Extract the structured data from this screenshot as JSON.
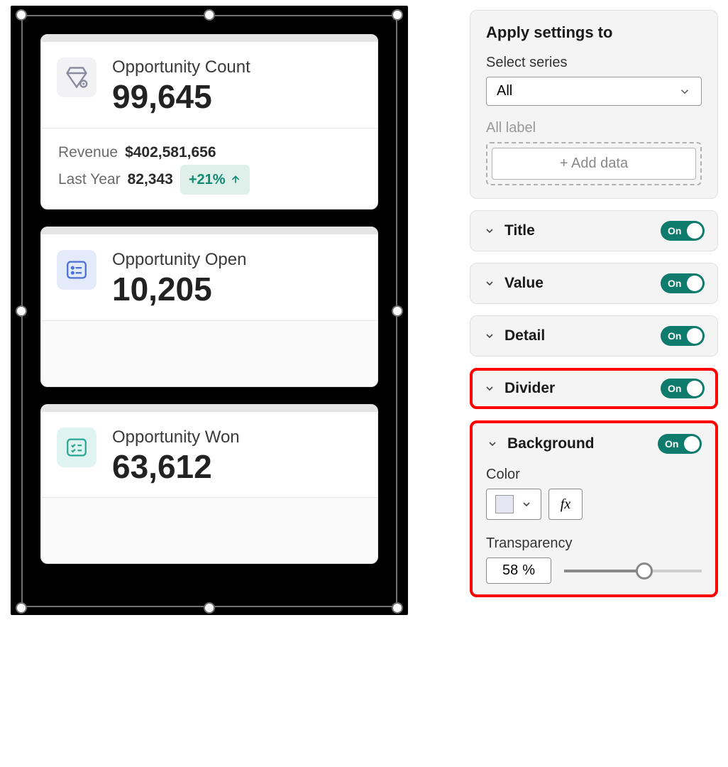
{
  "cards": [
    {
      "icon": "diamond-icon",
      "title": "Opportunity Count",
      "value": "99,645",
      "footer": {
        "rows": [
          {
            "label": "Revenue",
            "value": "$402,581,656"
          },
          {
            "label": "Last Year",
            "value": "82,343",
            "delta": "+21%",
            "delta_direction": "up"
          }
        ]
      }
    },
    {
      "icon": "list-icon",
      "title": "Opportunity Open",
      "value": "10,205"
    },
    {
      "icon": "checklist-icon",
      "title": "Opportunity Won",
      "value": "63,612"
    }
  ],
  "panel": {
    "apply_heading": "Apply settings to",
    "select_series_label": "Select series",
    "select_series_value": "All",
    "all_label": "All label",
    "add_data": "+ Add data",
    "sections": {
      "title": {
        "label": "Title",
        "toggle": "On"
      },
      "value": {
        "label": "Value",
        "toggle": "On"
      },
      "detail": {
        "label": "Detail",
        "toggle": "On"
      },
      "divider": {
        "label": "Divider",
        "toggle": "On"
      },
      "background": {
        "label": "Background",
        "toggle": "On",
        "color_label": "Color",
        "color_value": "#e6e5f2",
        "fx_label": "fx",
        "transparency_label": "Transparency",
        "transparency_value": "58",
        "transparency_unit": "%"
      }
    }
  }
}
